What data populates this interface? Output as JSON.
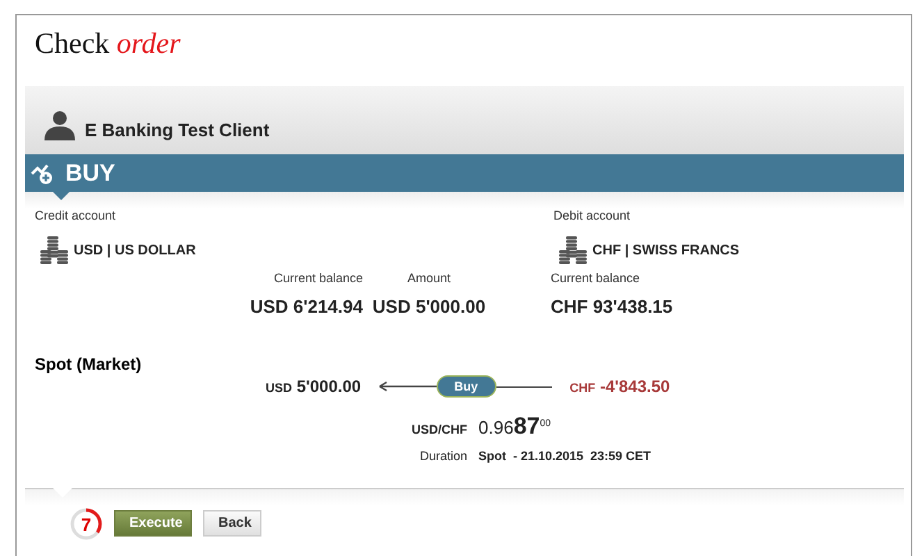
{
  "title": {
    "plain": "Check",
    "accent": "order"
  },
  "client": {
    "name": "E Banking Test Client"
  },
  "order_type": {
    "label": "BUY"
  },
  "credit_account": {
    "label": "Credit account",
    "currency": "USD | US DOLLAR"
  },
  "debit_account": {
    "label": "Debit account",
    "currency": "CHF | SWISS FRANCS"
  },
  "balances": [
    {
      "label": "Current balance",
      "value": "USD 6'214.94"
    },
    {
      "label": "Amount",
      "value": "USD 5'000.00"
    },
    {
      "label": "Current balance",
      "value": "CHF 93'438.15"
    }
  ],
  "trade": {
    "label": "Spot (Market)",
    "buy_currency": "USD",
    "buy_amount": "5'000.00",
    "action": "Buy",
    "sell_currency": "CHF",
    "sell_amount": "-4'843.50"
  },
  "rate": {
    "label": "USD/CHF",
    "small": "0.96",
    "big": "87",
    "sup": "00"
  },
  "duration": {
    "label": "Duration",
    "value": "Spot  - 21.10.2015  23:59 CET"
  },
  "timer": {
    "count": "7",
    "level": 0.35
  },
  "buttons": [
    {
      "label": "Execute",
      "kind": "primary"
    },
    {
      "label": "Back",
      "kind": "secondary"
    }
  ]
}
